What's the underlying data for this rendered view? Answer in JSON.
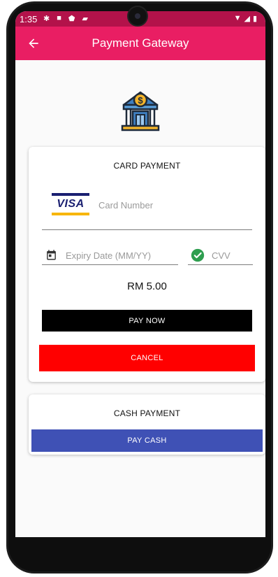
{
  "status_bar": {
    "time": "1:35"
  },
  "app_bar": {
    "title": "Payment Gateway"
  },
  "card_payment": {
    "title": "CARD PAYMENT",
    "card_brand": "VISA",
    "card_number_placeholder": "Card Number",
    "expiry_placeholder": "Expiry Date (MM/YY)",
    "cvv_placeholder": "CVV",
    "amount": "RM 5.00",
    "pay_now_label": "PAY NOW",
    "cancel_label": "CANCEL"
  },
  "cash_payment": {
    "title": "CASH PAYMENT",
    "pay_cash_label": "PAY CASH"
  },
  "colors": {
    "app_bar": "#e91e63",
    "status_bar": "#b3124a",
    "pay_now": "#000000",
    "cancel": "#ff0000",
    "pay_cash": "#3f51b5",
    "cvv_check": "#2e9e4f"
  }
}
